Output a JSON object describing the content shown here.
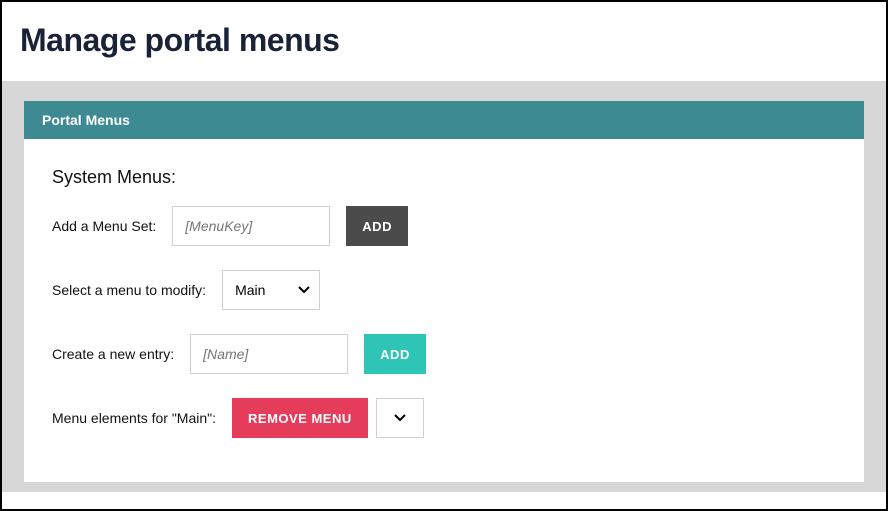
{
  "page": {
    "title": "Manage portal menus"
  },
  "panel": {
    "header": "Portal Menus",
    "sectionTitle": "System Menus:",
    "addMenuSet": {
      "label": "Add a Menu Set:",
      "placeholder": "[MenuKey]",
      "button": "Add"
    },
    "selectMenu": {
      "label": "Select a menu to modify:",
      "value": "Main"
    },
    "createEntry": {
      "label": "Create a new entry:",
      "placeholder": "[Name]",
      "button": "Add"
    },
    "menuElements": {
      "label": "Menu elements for \"Main\":",
      "removeButton": "Remove Menu"
    }
  }
}
